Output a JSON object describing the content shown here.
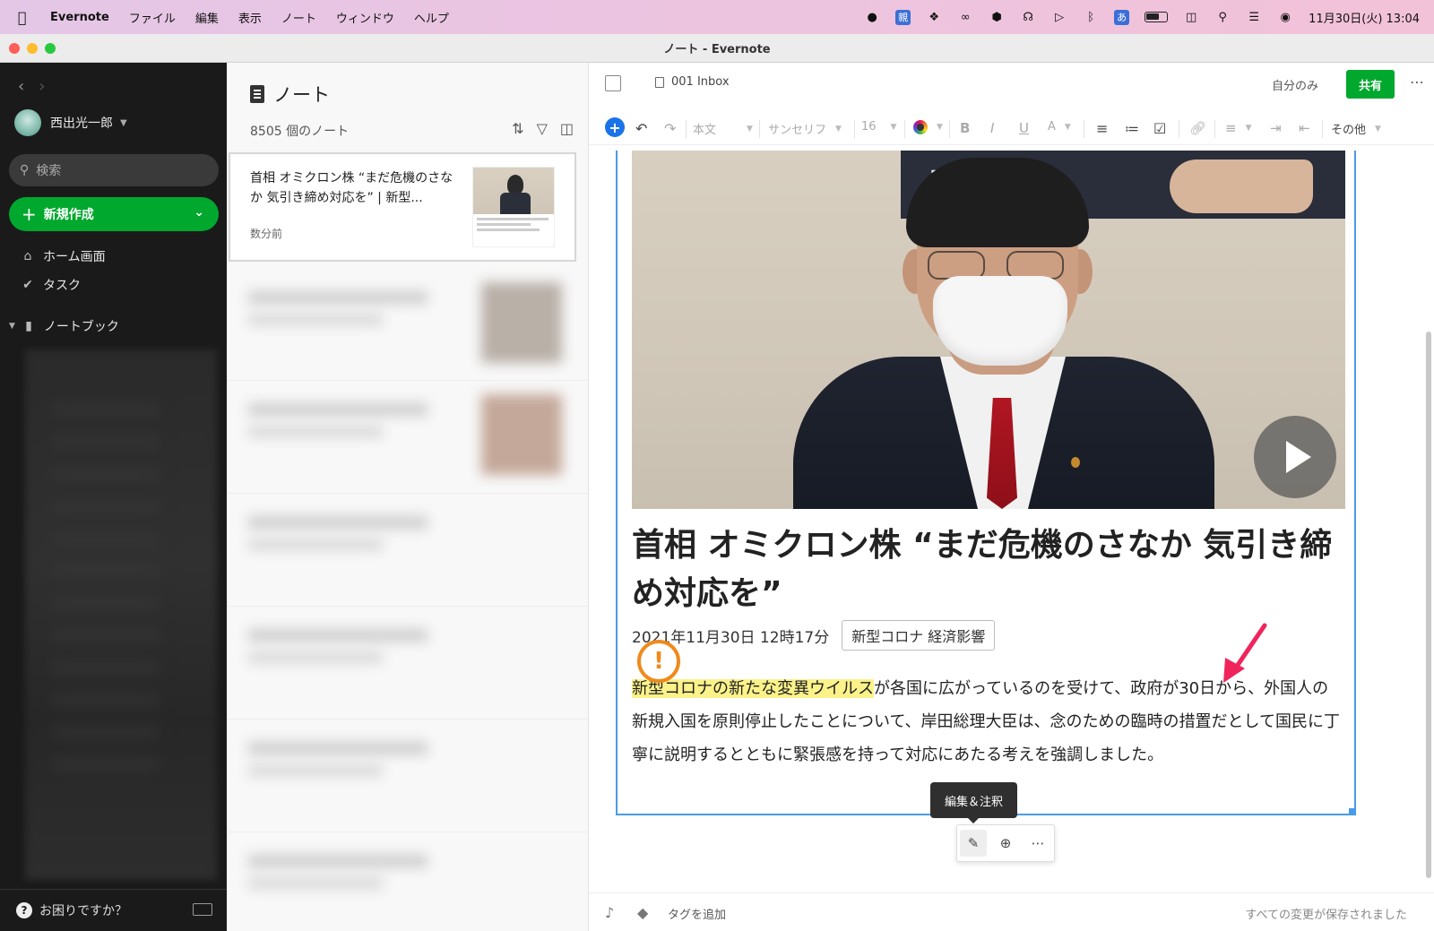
{
  "menubar": {
    "app_name": "Evernote",
    "items": [
      "ファイル",
      "編集",
      "表示",
      "ノート",
      "ウィンドウ",
      "ヘルプ"
    ],
    "ime_label": "親",
    "ime_kana": "あ",
    "clock": "11月30日(火) 13:04"
  },
  "window": {
    "title": "ノート - Evernote"
  },
  "sidebar": {
    "user_name": "西出光一郎",
    "search_placeholder": "検索",
    "new_button": "新規作成",
    "nav": {
      "home": "ホーム画面",
      "tasks": "タスク",
      "notebooks": "ノートブック"
    },
    "help": "お困りですか？"
  },
  "notelist": {
    "title": "ノート",
    "count": "8505 個のノート",
    "first_note": {
      "title": "首相 オミクロン株 “まだ危機のさなか 気引き締め対応を” | 新型...",
      "time": "数分前"
    }
  },
  "editor": {
    "notebook": "001 Inbox",
    "visibility": "自分のみ",
    "share": "共有",
    "toolbar": {
      "style": "本文",
      "font": "サンセリフ",
      "size": "16",
      "more": "その他"
    },
    "note": {
      "banner_text": "民党",
      "headline": "首相 オミクロン株 “まだ危機のさなか 気引き締め対応を”",
      "date": "2021年11月30日 12時17分",
      "tag": "新型コロナ 経済影響",
      "body_highlight": "新型コロナの新たな変異ウイルス",
      "body_rest": "が各国に広がっているのを受けて、政府が30日から、外国人の新規入国を原則停止したことについて、岸田総理大臣は、念のための臨時の措置だとして国民に丁寧に説明するとともに緊張感を持って対応にあたる考えを強調しました。"
    },
    "tooltip": "編集＆注釈",
    "footer": {
      "add_tag": "タグを追加",
      "saved": "すべての変更が保存されました"
    }
  },
  "colors": {
    "accent_green": "#00a82d",
    "select_blue": "#4a9be8",
    "highlight": "#fbf28a",
    "warn_orange": "#f08a1c",
    "arrow_pink": "#f0245c"
  }
}
